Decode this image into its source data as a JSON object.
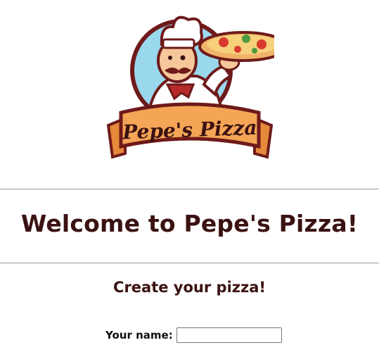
{
  "header": {
    "logo_icon": "pepes-pizza-chef-logo-icon",
    "logo_text": "Pepe's Pizza"
  },
  "main": {
    "title": "Welcome to Pepe's Pizza!",
    "subtitle": "Create your pizza!"
  },
  "form": {
    "name_label": "Your name:",
    "name_value": "",
    "name_placeholder": ""
  },
  "colors": {
    "heading": "#3b1212",
    "logo_outline": "#6e1a1a",
    "logo_circle": "#9ad8ee",
    "banner": "#f4a556"
  }
}
